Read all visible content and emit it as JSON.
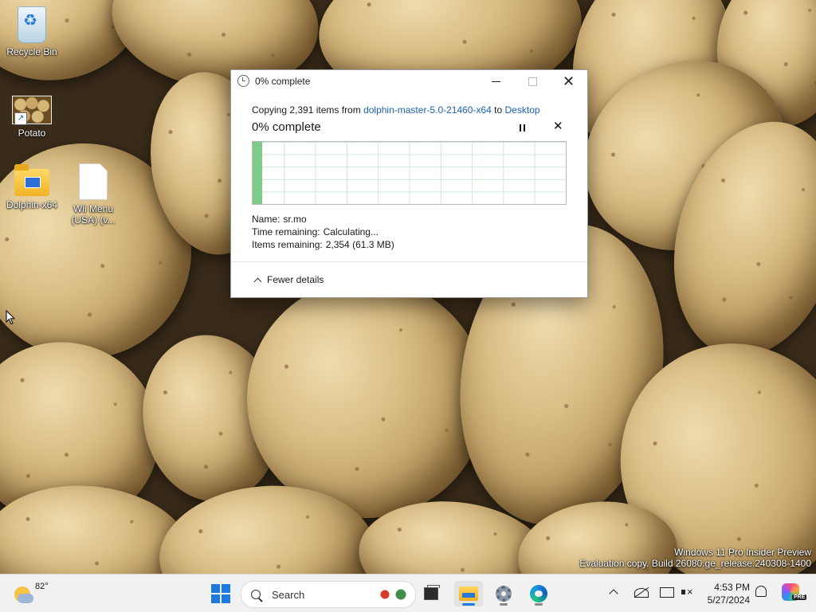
{
  "desktop": {
    "icons": [
      {
        "label": "Recycle Bin",
        "icon": "recycle-bin-icon"
      },
      {
        "label": "Potato",
        "icon": "image-shortcut-icon"
      },
      {
        "label": "Dolphin-x64",
        "icon": "folder-icon"
      },
      {
        "label_line1": "Wii Menu",
        "label_line2": "(USA) (v...",
        "icon": "file-icon"
      }
    ]
  },
  "dialog": {
    "title": "0% complete",
    "copy_prefix": "Copying 2,391 items from ",
    "source": "dolphin-master-5.0-21460-x64",
    "copy_mid": " to ",
    "destination": "Desktop",
    "status": "0% complete",
    "progress_fraction": 0.01,
    "name_label": "Name:",
    "name_value": "sr.mo",
    "time_label": "Time remaining:",
    "time_value": "Calculating...",
    "items_label": "Items remaining:",
    "items_value": "2,354 (61.3 MB)",
    "fewer_details": "Fewer details"
  },
  "watermark": {
    "line1": "Windows 11 Pro Insider Preview",
    "line2": "Evaluation copy. Build 26080.ge_release.240308-1400"
  },
  "taskbar": {
    "weather_temp": "82°",
    "search_placeholder": "Search",
    "clock_time": "4:53 PM",
    "clock_date": "5/27/2024",
    "copilot_badge": "PRE"
  },
  "colors": {
    "accent": "#1f7ae0",
    "link": "#1d61b5",
    "graph_grid": "#cfe8d6",
    "progress": "#7ccb8b"
  }
}
